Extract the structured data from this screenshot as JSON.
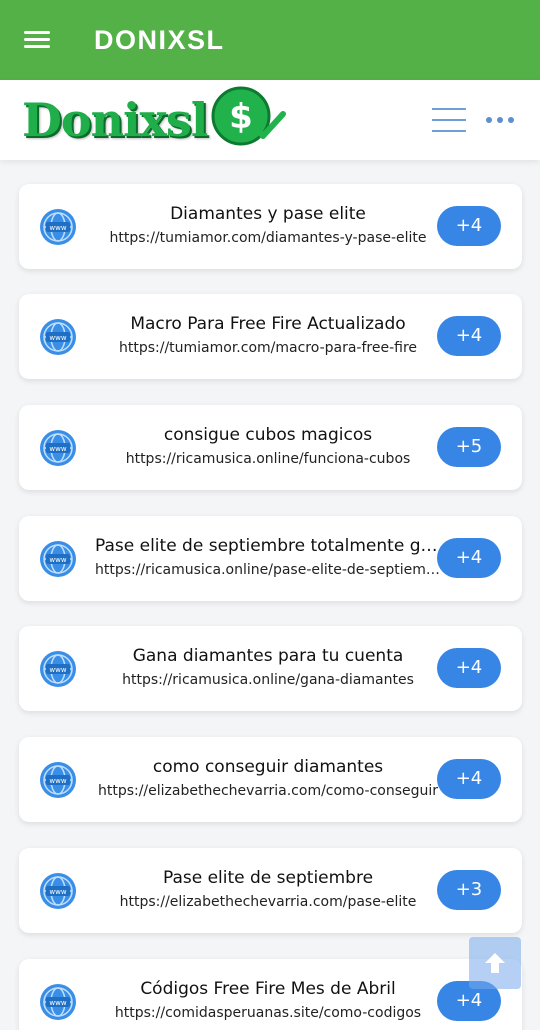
{
  "appbar": {
    "title": "DONIXSL",
    "menu_icon": "menu-icon"
  },
  "brand": {
    "logo_text": "Donixsl",
    "logo_symbol": "$",
    "colors": {
      "green": "#1fae4a",
      "appbar": "#53b148",
      "badge": "#3786e6"
    }
  },
  "items": [
    {
      "title": "Diamantes y pase elite",
      "url": "https://tumiamor.com/diamantes-y-pase-elite",
      "badge": "+4"
    },
    {
      "title": "Macro Para Free Fire Actualizado",
      "url": "https://tumiamor.com/macro-para-free-fire",
      "badge": "+4"
    },
    {
      "title": "consigue cubos magicos",
      "url": "https://ricamusica.online/funciona-cubos",
      "badge": "+5"
    },
    {
      "title": "Pase elite de septiembre totalmente gratis",
      "url": "https://ricamusica.online/pase-elite-de-septiembre",
      "badge": "+4"
    },
    {
      "title": "Gana diamantes para tu cuenta",
      "url": "https://ricamusica.online/gana-diamantes",
      "badge": "+4"
    },
    {
      "title": "como conseguir diamantes",
      "url": "https://elizabethechevarria.com/como-conseguir",
      "badge": "+4"
    },
    {
      "title": "Pase elite de septiembre",
      "url": "https://elizabethechevarria.com/pase-elite",
      "badge": "+3"
    },
    {
      "title": "Códigos Free Fire Mes de Abril",
      "url": "https://comidasperuanas.site/como-codigos",
      "badge": "+4"
    }
  ],
  "scroll_top_icon": "arrow-up-icon"
}
